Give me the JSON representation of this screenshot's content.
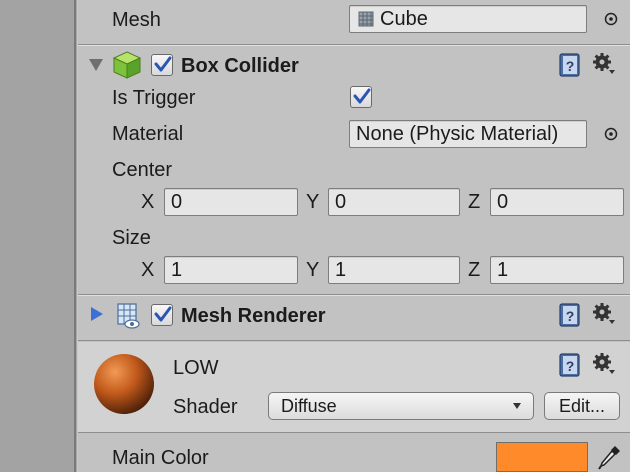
{
  "mesh_row": {
    "label": "Mesh",
    "value": "Cube"
  },
  "box_collider": {
    "title": "Box Collider",
    "enabled": true,
    "is_trigger_label": "Is Trigger",
    "is_trigger": true,
    "material_label": "Material",
    "material_value": "None (Physic Material)",
    "center_label": "Center",
    "center": {
      "x_label": "X",
      "x": "0",
      "y_label": "Y",
      "y": "0",
      "z_label": "Z",
      "z": "0"
    },
    "size_label": "Size",
    "size": {
      "x_label": "X",
      "x": "1",
      "y_label": "Y",
      "y": "1",
      "z_label": "Z",
      "z": "1"
    }
  },
  "mesh_renderer": {
    "title": "Mesh Renderer",
    "enabled": true
  },
  "material": {
    "name": "LOW",
    "shader_label": "Shader",
    "shader_value": "Diffuse",
    "edit_label": "Edit...",
    "main_color_label": "Main Color",
    "main_color": "#ff8a2a"
  },
  "colors": {
    "panel": "#c2c2c2",
    "accent_blue": "#3d6fd8",
    "check": "#2a55b5"
  },
  "icons": [
    "grid-mesh-icon",
    "target-icon",
    "collider-cube-icon",
    "help-book-icon",
    "gear-icon",
    "fold-arrow-icon",
    "mesh-renderer-icon",
    "material-sphere-icon",
    "dropdown-arrow-icon",
    "eyedropper-icon"
  ]
}
